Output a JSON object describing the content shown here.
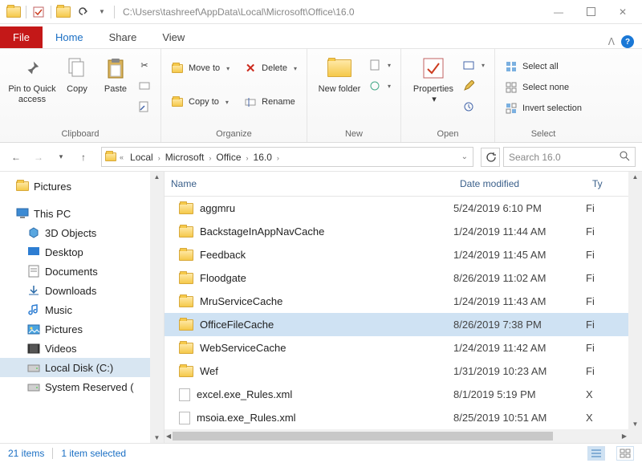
{
  "title_path": "C:\\Users\\tashreef\\AppData\\Local\\Microsoft\\Office\\16.0",
  "tabs": {
    "file": "File",
    "home": "Home",
    "share": "Share",
    "view": "View"
  },
  "ribbon": {
    "pin": "Pin to Quick access",
    "copy": "Copy",
    "paste": "Paste",
    "moveto": "Move to",
    "copyto": "Copy to",
    "delete": "Delete",
    "rename": "Rename",
    "newfolder": "New folder",
    "properties": "Properties",
    "selectall": "Select all",
    "selectnone": "Select none",
    "invert": "Invert selection",
    "g_clip": "Clipboard",
    "g_org": "Organize",
    "g_new": "New",
    "g_open": "Open",
    "g_sel": "Select"
  },
  "breadcrumb": [
    "Local",
    "Microsoft",
    "Office",
    "16.0"
  ],
  "search_placeholder": "Search 16.0",
  "nav": [
    {
      "label": "Pictures",
      "level": 0,
      "icon": "folder"
    },
    {
      "label": "This PC",
      "level": 0,
      "icon": "pc"
    },
    {
      "label": "3D Objects",
      "level": 1,
      "icon": "3d"
    },
    {
      "label": "Desktop",
      "level": 1,
      "icon": "desktop"
    },
    {
      "label": "Documents",
      "level": 1,
      "icon": "docs"
    },
    {
      "label": "Downloads",
      "level": 1,
      "icon": "down"
    },
    {
      "label": "Music",
      "level": 1,
      "icon": "music"
    },
    {
      "label": "Pictures",
      "level": 1,
      "icon": "pics"
    },
    {
      "label": "Videos",
      "level": 1,
      "icon": "vids"
    },
    {
      "label": "Local Disk (C:)",
      "level": 1,
      "icon": "disk",
      "selected": true
    },
    {
      "label": "System Reserved (",
      "level": 1,
      "icon": "disk"
    }
  ],
  "columns": {
    "name": "Name",
    "date": "Date modified",
    "type": "Ty"
  },
  "files": [
    {
      "name": "aggmru",
      "date": "5/24/2019 6:10 PM",
      "type": "Fi",
      "icon": "folder"
    },
    {
      "name": "BackstageInAppNavCache",
      "date": "1/24/2019 11:44 AM",
      "type": "Fi",
      "icon": "folder"
    },
    {
      "name": "Feedback",
      "date": "1/24/2019 11:45 AM",
      "type": "Fi",
      "icon": "folder"
    },
    {
      "name": "Floodgate",
      "date": "8/26/2019 11:02 AM",
      "type": "Fi",
      "icon": "folder"
    },
    {
      "name": "MruServiceCache",
      "date": "1/24/2019 11:43 AM",
      "type": "Fi",
      "icon": "folder"
    },
    {
      "name": "OfficeFileCache",
      "date": "8/26/2019 7:38 PM",
      "type": "Fi",
      "icon": "folder",
      "selected": true
    },
    {
      "name": "WebServiceCache",
      "date": "1/24/2019 11:42 AM",
      "type": "Fi",
      "icon": "folder"
    },
    {
      "name": "Wef",
      "date": "1/31/2019 10:23 AM",
      "type": "Fi",
      "icon": "folder"
    },
    {
      "name": "excel.exe_Rules.xml",
      "date": "8/1/2019 5:19 PM",
      "type": "X",
      "icon": "file"
    },
    {
      "name": "msoia.exe_Rules.xml",
      "date": "8/25/2019 10:51 AM",
      "type": "X",
      "icon": "file"
    }
  ],
  "status": {
    "count": "21 items",
    "selected": "1 item selected"
  }
}
